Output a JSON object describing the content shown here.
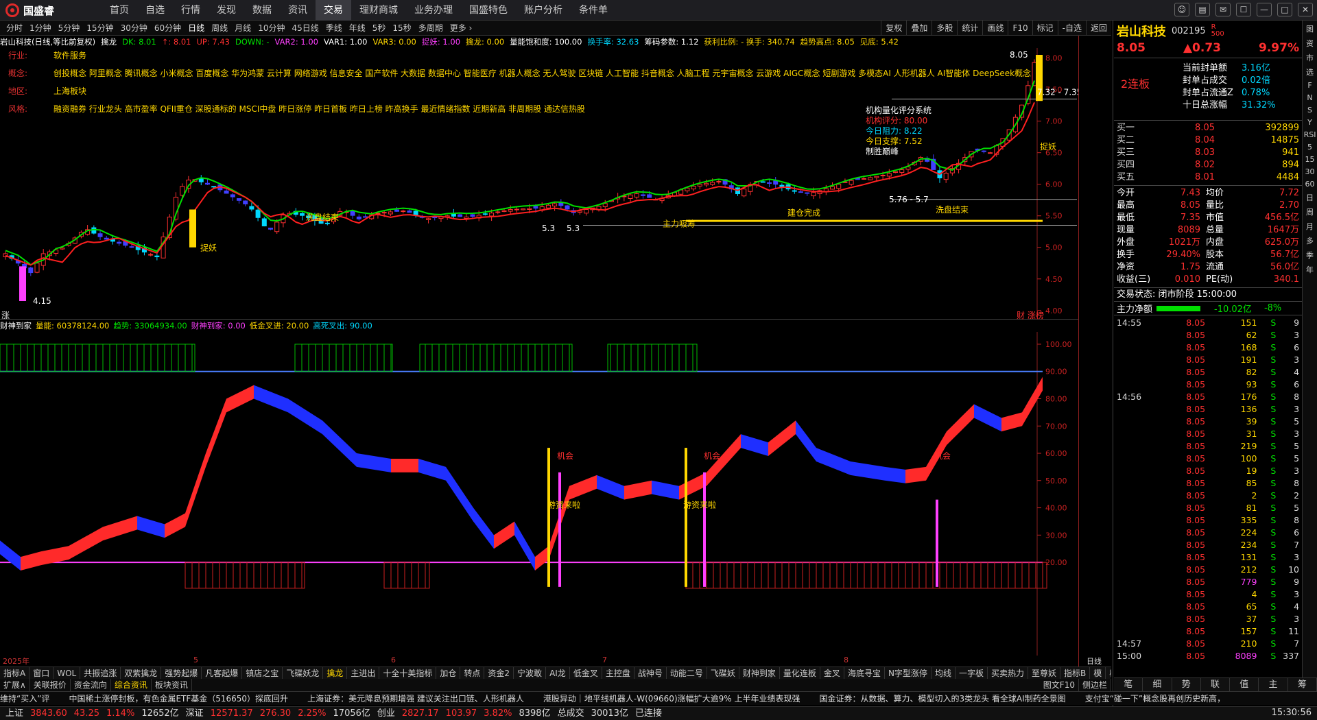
{
  "app": {
    "name": "国盛睿"
  },
  "top_menu": [
    "首页",
    "自选",
    "行情",
    "发现",
    "数据",
    "资讯",
    "交易",
    "理财商城",
    "业务办理",
    "国盛特色",
    "账户分析",
    "条件单"
  ],
  "top_menu_active": "交易",
  "window_controls": [
    "☺",
    "▤",
    "✉",
    "☐",
    "—",
    "□",
    "✕"
  ],
  "periods": [
    "分时",
    "1分钟",
    "5分钟",
    "15分钟",
    "30分钟",
    "60分钟",
    "日线",
    "周线",
    "月线",
    "10分钟",
    "45日线",
    "季线",
    "年线",
    "5秒",
    "15秒",
    "多周期",
    "更多 ›"
  ],
  "period_active": "日线",
  "tools": [
    "复权",
    "叠加",
    "多股",
    "统计",
    "画线",
    "F10",
    "标记",
    "-自选",
    "返回"
  ],
  "indicator_line": [
    {
      "t": "岩山科技(日线,等比前复权)",
      "c": "#ffffff"
    },
    {
      "t": "擒龙",
      "c": "#ffffff"
    },
    {
      "t": "DK: 8.01",
      "c": "#00e000"
    },
    {
      "t": "↑: 8.01",
      "c": "#ff3030"
    },
    {
      "t": "UP: 7.43",
      "c": "#ff3030"
    },
    {
      "t": "DOWN: -",
      "c": "#00e000"
    },
    {
      "t": "VAR2: 1.00",
      "c": "#ff40ff"
    },
    {
      "t": "VAR1: 1.00",
      "c": "#ffffff"
    },
    {
      "t": "VAR3: 0.00",
      "c": "#ffd700"
    },
    {
      "t": "捉妖: 1.00",
      "c": "#ff40ff"
    },
    {
      "t": "擒龙: 0.00",
      "c": "#ffd700"
    },
    {
      "t": "量能饱和度: 100.00",
      "c": "#ffffff"
    },
    {
      "t": "换手率: 32.63",
      "c": "#00d8ff"
    },
    {
      "t": "筹码参数: 1.12",
      "c": "#ffffff"
    },
    {
      "t": "获利比例: - 换手: 340.74",
      "c": "#ffd700"
    },
    {
      "t": "趋势高点: 8.05",
      "c": "#ffd700"
    },
    {
      "t": "见底: 5.42",
      "c": "#ffd700"
    }
  ],
  "stock_info": {
    "industry_label": "行业:",
    "industry": "软件服务",
    "concept_label": "概念:",
    "concepts": "创投概念 阿里概念 腾讯概念 小米概念 百度概念 华为鸿蒙 云计算 网络游戏 信息安全 国产软件 大数据 数据中心 智能医疗 机器人概念 无人驾驶 区块链 人工智能 抖音概念 人脑工程 元宇宙概念 云游戏 AIGC概念 短剧游戏 多模态AI 人形机器人 AI智能体 DeepSeek概念",
    "region_label": "地区:",
    "region": "上海板块",
    "style_label": "风格:",
    "styles": "融资融券 行业龙头 高市盈率 QFII重仓 深股通标的 MSCI中盘 昨日涨停 昨日首板 昨日上榜 昨高换手 最近情绪指数 近期新高 非周期股 通达信热股"
  },
  "rating": {
    "title": "机构量化评分系统",
    "score": "机构评分: 80.00",
    "resist": "今日阻力: 8.22",
    "support": "今日支撑: 7.52",
    "verdict": "制胜巅峰"
  },
  "main_annotations": {
    "low": "4.15",
    "high": "8.05",
    "range1": "7.32 - 7.35",
    "range2": "5.76 - 5.7",
    "l1": "5.3",
    "l2": "5.3",
    "zhuoyao": "捉妖",
    "xipan": "洗盘结束",
    "zhuli": "主力吸筹",
    "jiancang": "建仓完成",
    "caizhang": "财 涨榜",
    "zhang": "涨"
  },
  "main_axis": [
    "8.00",
    "7.50",
    "7.00",
    "6.50",
    "6.00",
    "5.50",
    "5.00",
    "4.50",
    "4.00"
  ],
  "sub_header": [
    {
      "t": "财神到家",
      "c": "#ffffff"
    },
    {
      "t": "量能: 60378124.00",
      "c": "#ffd700"
    },
    {
      "t": "趋势: 33064934.00",
      "c": "#00e000"
    },
    {
      "t": "财神到家: 0.00",
      "c": "#ff40ff"
    },
    {
      "t": "低金叉进: 20.00",
      "c": "#ffd700"
    },
    {
      "t": "高死叉出: 90.00",
      "c": "#00d8ff"
    }
  ],
  "sub_axis": [
    "100.00",
    "90.00",
    "80.00",
    "70.00",
    "60.00",
    "50.00",
    "40.00",
    "30.00",
    "20.00"
  ],
  "sub_annotations": {
    "jihui": "机会",
    "youzi": "游资来啦"
  },
  "dates": {
    "year": "2025年",
    "m5": "5",
    "m6": "6",
    "m7": "7",
    "m8": "8",
    "period": "日线"
  },
  "tabs1": [
    "指标A",
    "窗口",
    "WOL",
    "共振追涨",
    "双紫擒龙",
    "强势起爆",
    "凡客起爆",
    "镇店之宝",
    "飞碟妖龙",
    "擒龙",
    "主进出",
    "十全十美指标",
    "加仓",
    "转点",
    "资金2",
    "宁波敢",
    "AI龙",
    "低金叉",
    "主控盘",
    "战神号",
    "动能二号",
    "飞碟妖",
    "财神到家",
    "量化连板",
    "金叉",
    "海底寻宝",
    "N字型涨停",
    "均线",
    "一字板",
    "买卖热力",
    "至尊妖",
    "指标B",
    "模",
    "板"
  ],
  "tabs1_active": "擒龙",
  "tabs2": [
    "扩展∧",
    "关联报价",
    "资金流向",
    "综合资讯",
    "板块资讯"
  ],
  "tabs2_active": "综合资讯",
  "tabs2_right": [
    "图文F10",
    "侧边栏"
  ],
  "news": [
    "维持“买入”评",
    "中国稀土涨停封板，有色金属ETF基金（516650）探底回升",
    "上海证券：美元降息预期增强 建议关注出口链、人形机器人",
    "港股异动｜地平线机器人-W(09660)涨幅扩大逾9% 上半年业绩表现强",
    "国金证券：从数据、算力、模型切入的3类龙头 看全球AI制药全景图",
    "支付宝“碰一下”概念股再创历史新高，"
  ],
  "status": [
    {
      "t": "上证",
      "c": "#ddd"
    },
    {
      "t": "3843.60",
      "c": "#ff3030"
    },
    {
      "t": "43.25",
      "c": "#ff3030"
    },
    {
      "t": "1.14%",
      "c": "#ff3030"
    },
    {
      "t": "12652亿",
      "c": "#ddd"
    },
    {
      "t": "深证",
      "c": "#ddd"
    },
    {
      "t": "12571.37",
      "c": "#ff3030"
    },
    {
      "t": "276.30",
      "c": "#ff3030"
    },
    {
      "t": "2.25%",
      "c": "#ff3030"
    },
    {
      "t": "17056亿",
      "c": "#ddd"
    },
    {
      "t": "创业",
      "c": "#ddd"
    },
    {
      "t": "2827.17",
      "c": "#ff3030"
    },
    {
      "t": "103.97",
      "c": "#ff3030"
    },
    {
      "t": "3.82%",
      "c": "#ff3030"
    },
    {
      "t": "8398亿",
      "c": "#ddd"
    },
    {
      "t": "总成交",
      "c": "#ddd"
    },
    {
      "t": "30013亿",
      "c": "#ddd"
    },
    {
      "t": "已连接",
      "c": "#ddd"
    }
  ],
  "clock": "15:30:56",
  "quote": {
    "name": "岩山科技",
    "code": "002195",
    "tag": "R",
    "sub": "500",
    "price": "8.05",
    "change": "▲0.73",
    "pct": "9.97%",
    "board": "2连板",
    "seal_lines": [
      {
        "k": "当前封单额",
        "v": "3.16亿"
      },
      {
        "k": "封单占成交",
        "v": "0.02倍"
      },
      {
        "k": "封单占流通Z",
        "v": "0.78%"
      },
      {
        "k": "十日总涨幅",
        "v": "31.32%"
      }
    ],
    "book": [
      {
        "k": "买一",
        "p": "8.05",
        "v": "392899"
      },
      {
        "k": "买二",
        "p": "8.04",
        "v": "14875"
      },
      {
        "k": "买三",
        "p": "8.03",
        "v": "941"
      },
      {
        "k": "买四",
        "p": "8.02",
        "v": "894"
      },
      {
        "k": "买五",
        "p": "8.01",
        "v": "4484"
      }
    ],
    "stats": [
      {
        "k1": "今开",
        "v1": "7.43",
        "k2": "均价",
        "v2": "7.72"
      },
      {
        "k1": "最高",
        "v1": "8.05",
        "k2": "量比",
        "v2": "2.70"
      },
      {
        "k1": "最低",
        "v1": "7.35",
        "k2": "市值",
        "v2": "456.5亿"
      },
      {
        "k1": "现量",
        "v1": "8089",
        "k2": "总量",
        "v2": "1647万"
      },
      {
        "k1": "外盘",
        "v1": "1021万",
        "k2": "内盘",
        "v2": "625.0万"
      },
      {
        "k1": "换手",
        "v1": "29.40%",
        "k2": "股本",
        "v2": "56.7亿"
      },
      {
        "k1": "净资",
        "v1": "1.75",
        "k2": "流通",
        "v2": "56.0亿"
      },
      {
        "k1": "收益(三)",
        "v1": "0.010",
        "k2": "PE(动)",
        "v2": "340.1"
      }
    ],
    "trade_state": "交易状态: 闭市阶段 15:00:00",
    "net_label": "主力净额",
    "net_value": "-10.02亿",
    "net_pct": "-8%"
  },
  "ticks": [
    {
      "t": "14:55",
      "p": "8.05",
      "v": "151",
      "d": "S",
      "n": "9"
    },
    {
      "t": "",
      "p": "8.05",
      "v": "62",
      "d": "S",
      "n": "3"
    },
    {
      "t": "",
      "p": "8.05",
      "v": "168",
      "d": "S",
      "n": "6"
    },
    {
      "t": "",
      "p": "8.05",
      "v": "191",
      "d": "S",
      "n": "3"
    },
    {
      "t": "",
      "p": "8.05",
      "v": "82",
      "d": "S",
      "n": "4"
    },
    {
      "t": "",
      "p": "8.05",
      "v": "93",
      "d": "S",
      "n": "6"
    },
    {
      "t": "14:56",
      "p": "8.05",
      "v": "176",
      "d": "S",
      "n": "8"
    },
    {
      "t": "",
      "p": "8.05",
      "v": "136",
      "d": "S",
      "n": "3"
    },
    {
      "t": "",
      "p": "8.05",
      "v": "39",
      "d": "S",
      "n": "5"
    },
    {
      "t": "",
      "p": "8.05",
      "v": "31",
      "d": "S",
      "n": "3"
    },
    {
      "t": "",
      "p": "8.05",
      "v": "219",
      "d": "S",
      "n": "5"
    },
    {
      "t": "",
      "p": "8.05",
      "v": "100",
      "d": "S",
      "n": "5"
    },
    {
      "t": "",
      "p": "8.05",
      "v": "19",
      "d": "S",
      "n": "3"
    },
    {
      "t": "",
      "p": "8.05",
      "v": "85",
      "d": "S",
      "n": "8"
    },
    {
      "t": "",
      "p": "8.05",
      "v": "2",
      "d": "S",
      "n": "2"
    },
    {
      "t": "",
      "p": "8.05",
      "v": "81",
      "d": "S",
      "n": "5"
    },
    {
      "t": "",
      "p": "8.05",
      "v": "335",
      "d": "S",
      "n": "8"
    },
    {
      "t": "",
      "p": "8.05",
      "v": "224",
      "d": "S",
      "n": "6"
    },
    {
      "t": "",
      "p": "8.05",
      "v": "234",
      "d": "S",
      "n": "7"
    },
    {
      "t": "",
      "p": "8.05",
      "v": "131",
      "d": "S",
      "n": "3"
    },
    {
      "t": "",
      "p": "8.05",
      "v": "212",
      "d": "S",
      "n": "10"
    },
    {
      "t": "",
      "p": "8.05",
      "v": "779",
      "d": "S",
      "n": "9"
    },
    {
      "t": "",
      "p": "8.05",
      "v": "4",
      "d": "S",
      "n": "3"
    },
    {
      "t": "",
      "p": "8.05",
      "v": "65",
      "d": "S",
      "n": "4"
    },
    {
      "t": "",
      "p": "8.05",
      "v": "37",
      "d": "S",
      "n": "3"
    },
    {
      "t": "",
      "p": "8.05",
      "v": "157",
      "d": "S",
      "n": "11"
    },
    {
      "t": "14:57",
      "p": "8.05",
      "v": "210",
      "d": "S",
      "n": "7"
    },
    {
      "t": "15:00",
      "p": "8.05",
      "v": "8089",
      "d": "S",
      "n": "337"
    }
  ],
  "right_tabs": [
    "笔",
    "细",
    "势",
    "联",
    "值",
    "主",
    "筹"
  ],
  "right_sidebar": [
    "图",
    "资",
    "市",
    "选",
    "F",
    "N",
    "S",
    "Y",
    "RSI",
    "5",
    "15",
    "30",
    "60",
    "日",
    "周",
    "月",
    "多",
    "季",
    "年"
  ]
}
